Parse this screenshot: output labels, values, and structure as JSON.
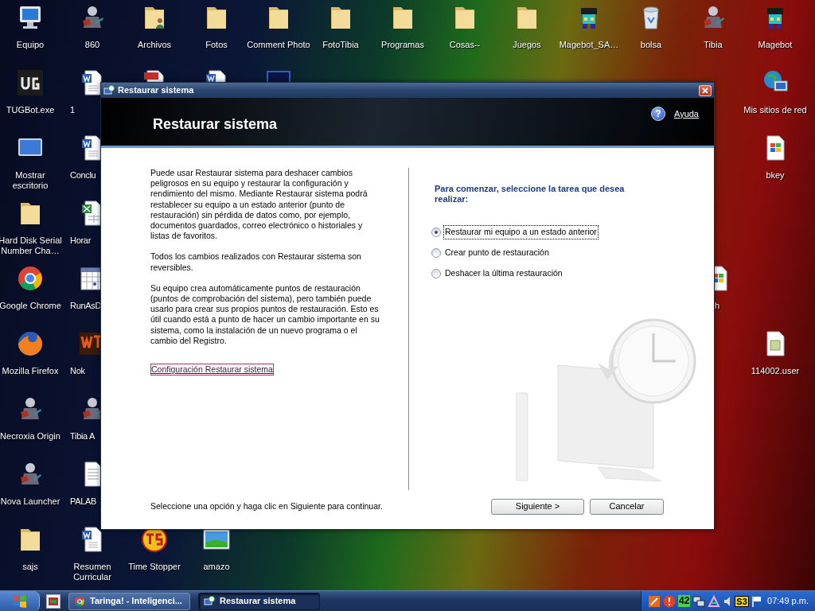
{
  "desktop_icons": [
    {
      "kind": "computer",
      "label": "Equipo"
    },
    {
      "kind": "character",
      "label": "860"
    },
    {
      "kind": "user-folder",
      "label": "Archivos"
    },
    {
      "kind": "folder",
      "label": "Fotos"
    },
    {
      "kind": "folder",
      "label": "Comment Photo"
    },
    {
      "kind": "folder",
      "label": "FotoTibia"
    },
    {
      "kind": "folder",
      "label": "Programas"
    },
    {
      "kind": "folder",
      "label": "Cosas--"
    },
    {
      "kind": "folder",
      "label": "Juegos"
    },
    {
      "kind": "sprite",
      "label": "Magebot_SA…"
    },
    {
      "kind": "trash",
      "label": "bolsa"
    },
    {
      "kind": "character",
      "label": "Tibia"
    },
    {
      "kind": "sprite",
      "label": "Magebot"
    },
    {
      "kind": "ug-logo",
      "label": "TUGBot.exe"
    },
    {
      "kind": "word",
      "label": "1"
    },
    {
      "kind": "pdf"
    },
    {
      "kind": "word"
    },
    {
      "kind": "app"
    },
    {
      "kind": "globe",
      "label": "Mis sitios de red"
    },
    {
      "kind": "desktop",
      "label": "Mostrar escritorio"
    },
    {
      "kind": "word",
      "label": "Conclu"
    },
    {
      "kind": "windows-file",
      "label": "bkey"
    },
    {
      "kind": "folder",
      "label": "Hard Disk Serial Number Cha…"
    },
    {
      "kind": "excel",
      "label": "Horar"
    },
    {
      "kind": "chrome",
      "label": "Google Chrome"
    },
    {
      "kind": "calendar",
      "label": "RunAsD"
    },
    {
      "kind": "windows-file",
      "label": "h"
    },
    {
      "kind": "firefox",
      "label": "Mozilla Firefox"
    },
    {
      "kind": "wt-logo",
      "label": "Nok"
    },
    {
      "kind": "script-file",
      "label": "114002.user"
    },
    {
      "kind": "character",
      "label": "Necroxia Origin"
    },
    {
      "kind": "character",
      "label": "Tibia A"
    },
    {
      "kind": "character",
      "label": "Nova Launcher"
    },
    {
      "kind": "document",
      "label": "PALAB"
    },
    {
      "kind": "folder",
      "label": "sajs"
    },
    {
      "kind": "word",
      "label": "Resumen Curricular"
    },
    {
      "kind": "ts-logo",
      "label": "Time Stopper"
    },
    {
      "kind": "image",
      "label": "amazo"
    }
  ],
  "window": {
    "title": "Restaurar sistema",
    "header_title": "Restaurar sistema",
    "help_icon": "?",
    "help_link": "Ayuda",
    "paragraphs": [
      "Puede usar Restaurar sistema para deshacer cambios peligrosos en su equipo y restaurar la configuración y rendimiento del mismo. Mediante Restaurar sistema podrá restablecer su equipo a un estado anterior (punto de restauración) sin pérdida de datos como, por ejemplo, documentos guardados, correo electrónico o historiales y listas de favoritos.",
      "Todos los cambios realizados con Restaurar sistema son reversibles.",
      "Su equipo crea automáticamente puntos de restauración (puntos de comprobación del sistema), pero también puede usarlo para crear sus propios puntos de restauración. Esto es útil cuando está a punto de hacer un cambio importante en su sistema, como la instalación de un nuevo programa o el cambio del Registro."
    ],
    "settings_link": "Configuración Restaurar sistema",
    "task_heading": "Para comenzar, seleccione la tarea que desea realizar:",
    "options": [
      {
        "label": "Restaurar mi equipo a un estado anterior",
        "selected": true
      },
      {
        "label": "Crear punto de restauración",
        "selected": false
      },
      {
        "label": "Deshacer la última restauración",
        "selected": false
      }
    ],
    "footer_hint": "Seleccione una opción y haga clic en Siguiente para continuar.",
    "buttons": [
      "Siguiente >",
      "Cancelar"
    ]
  },
  "taskbar": {
    "tasks": [
      {
        "label": "Taringa! - Inteligenci...",
        "selected": false
      },
      {
        "label": "Restaurar sistema",
        "selected": true
      }
    ],
    "tray_badges": [
      "42",
      "S3"
    ],
    "clock": "07:49 p.m."
  }
}
